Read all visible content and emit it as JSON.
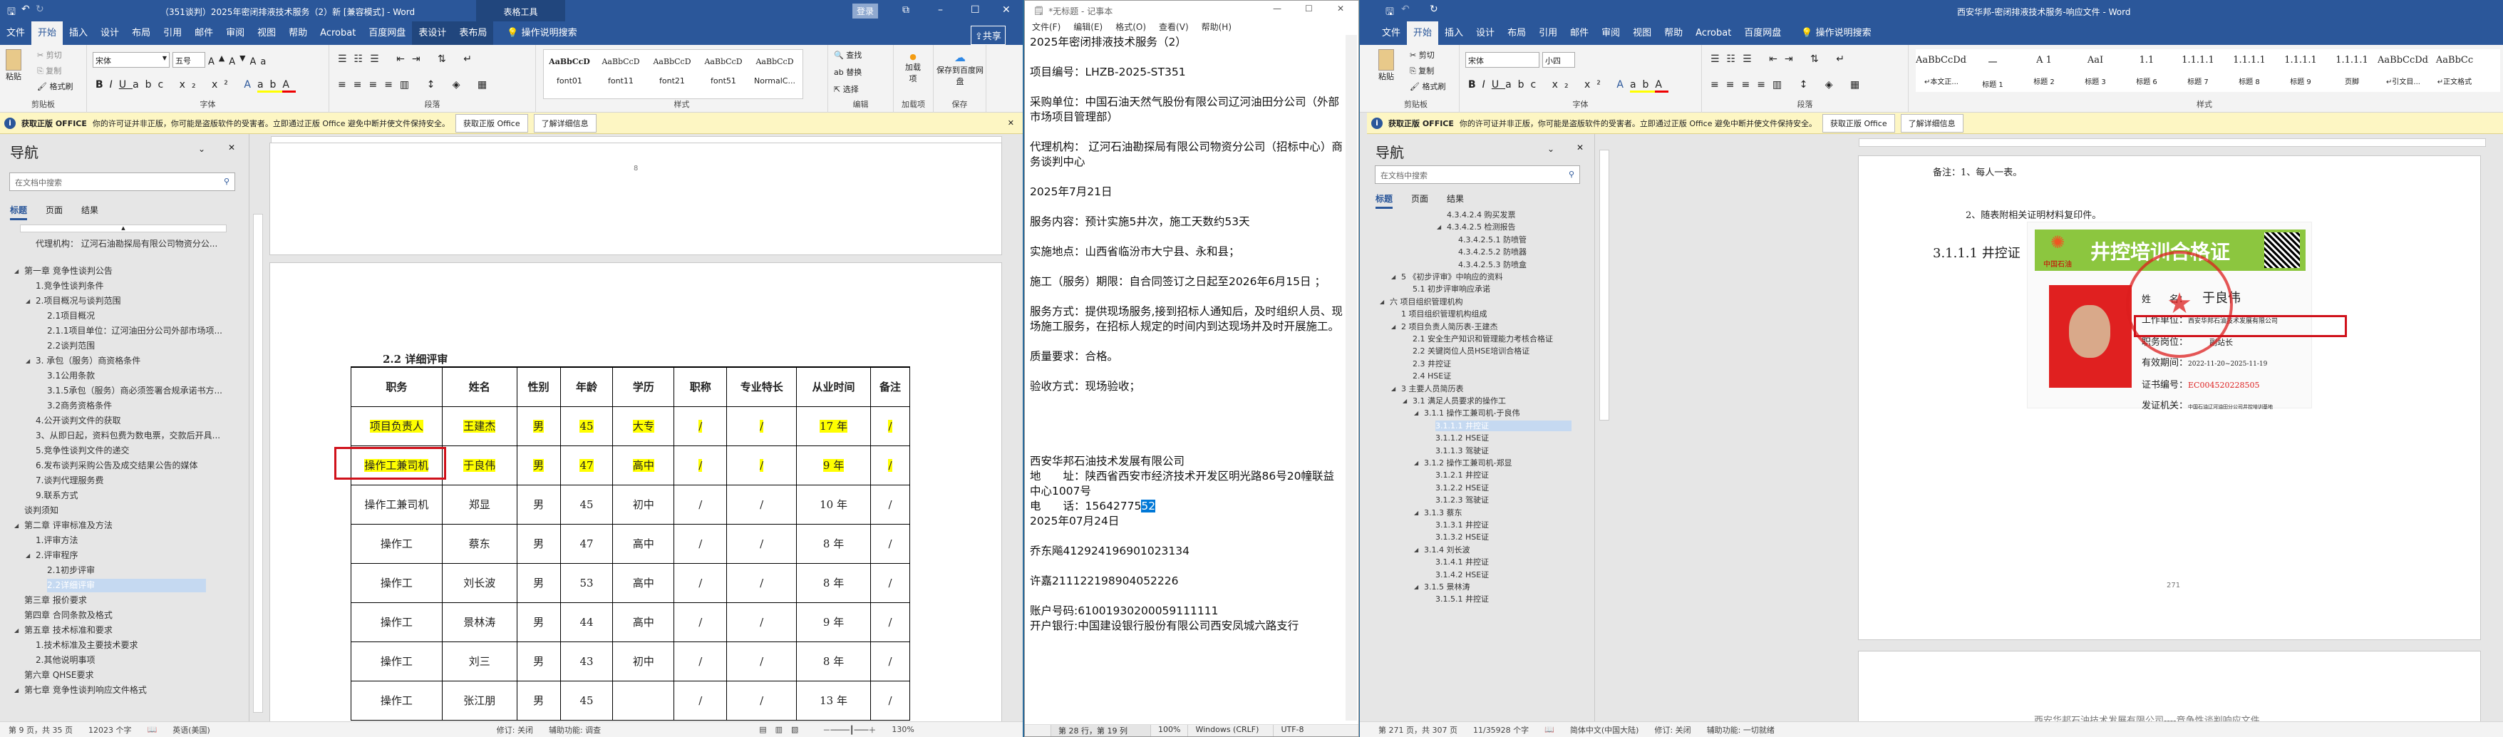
{
  "left_word": {
    "title": "（351谈判）2025年密闭排液技术服务（2）新 [兼容模式] - Word",
    "context_title": "表格工具",
    "login": "登录",
    "tabs": [
      "文件",
      "开始",
      "插入",
      "设计",
      "布局",
      "引用",
      "邮件",
      "审阅",
      "视图",
      "帮助",
      "Acrobat",
      "百度网盘",
      "表设计",
      "表布局"
    ],
    "tell_me": "操作说明搜索",
    "share": "共享",
    "ribbon": {
      "paste": "粘贴",
      "cut": "剪切",
      "copy": "复制",
      "format_painter": "格式刷",
      "clipboard": "剪贴板",
      "font_name": "宋体",
      "font_size": "五号",
      "font": "字体",
      "paragraph": "段落",
      "styles": [
        "font01",
        "font11",
        "font21",
        "font51",
        "NormalC..."
      ],
      "style_preview": "AaBbCcD",
      "styles_label": "样式",
      "find": "查找",
      "replace": "替换",
      "select": "选择",
      "editing": "编辑",
      "addins": "加载项",
      "addins_btn": "加载项",
      "save_baidu": "保存到百度网盘",
      "save": "保存"
    },
    "notice": {
      "title": "获取正版 OFFICE",
      "text": "你的许可证并非正版，你可能是盗版软件的受害者。立即通过正版 Office 避免中断并使文件保持安全。",
      "btn1": "获取正版 Office",
      "btn2": "了解详细信息"
    },
    "nav": {
      "title": "导航",
      "search": "在文档中搜索",
      "tabs": [
        "标题",
        "页面",
        "结果"
      ],
      "items": [
        {
          "t": "代理机构： 辽河石油勘探局有限公司物资分公...",
          "l": 1
        },
        {
          "t": "",
          "l": 0,
          "gap": true
        },
        {
          "t": "第一章 竞争性谈判公告",
          "l": 0,
          "e": true
        },
        {
          "t": "1.竞争性谈判条件",
          "l": 1
        },
        {
          "t": "2.项目概况与谈判范围",
          "l": 1,
          "e": true
        },
        {
          "t": "2.1项目概况",
          "l": 2
        },
        {
          "t": "2.1.1项目单位：辽河油田分公司外部市场项...",
          "l": 2
        },
        {
          "t": "2.2谈判范围",
          "l": 2
        },
        {
          "t": "3. 承包（服务）商资格条件",
          "l": 1,
          "e": true
        },
        {
          "t": "3.1公用条款",
          "l": 2
        },
        {
          "t": "3.1.5承包（服务）商必须签署合规承诺书方...",
          "l": 2
        },
        {
          "t": "3.2商务资格条件",
          "l": 2
        },
        {
          "t": "4.公开谈判文件的获取",
          "l": 1
        },
        {
          "t": "3、从即日起，资料包费为数电票，交款后开具...",
          "l": 1
        },
        {
          "t": "5.竞争性谈判文件的递交",
          "l": 1
        },
        {
          "t": "6.发布谈判采购公告及成交结果公告的媒体",
          "l": 1
        },
        {
          "t": "7.谈判代理服务费",
          "l": 1
        },
        {
          "t": "9.联系方式",
          "l": 1
        },
        {
          "t": "谈判须知",
          "l": 0
        },
        {
          "t": "第二章 评审标准及方法",
          "l": 0,
          "e": true
        },
        {
          "t": "1.评审方法",
          "l": 1
        },
        {
          "t": "2.评审程序",
          "l": 1,
          "e": true
        },
        {
          "t": "2.1初步评审",
          "l": 2
        },
        {
          "t": "2.2详细评审",
          "l": 2,
          "sel": true
        },
        {
          "t": "第三章 报价要求",
          "l": 0
        },
        {
          "t": "第四章 合同条款及格式",
          "l": 0
        },
        {
          "t": "第五章 技术标准和要求",
          "l": 0,
          "e": true
        },
        {
          "t": "1.技术标准及主要技术要求",
          "l": 1
        },
        {
          "t": "2.其他说明事项",
          "l": 1
        },
        {
          "t": "第六章 QHSE要求",
          "l": 0
        },
        {
          "t": "第七章 竞争性谈判响应文件格式",
          "l": 0,
          "e": true
        }
      ]
    },
    "prev_page_number": "8",
    "section_heading": "2.2 详细评审",
    "table": [
      [
        "职务",
        "姓名",
        "性别",
        "年龄",
        "学历",
        "职称",
        "专业特长",
        "从业时间",
        "备注"
      ],
      [
        "项目负责人",
        "王建杰",
        "男",
        "45",
        "大专",
        "/",
        "/",
        "17 年",
        "/"
      ],
      [
        "操作工兼司机",
        "于良伟",
        "男",
        "47",
        "高中",
        "/",
        "/",
        "9 年",
        "/"
      ],
      [
        "操作工兼司机",
        "郑显",
        "男",
        "45",
        "初中",
        "/",
        "/",
        "10 年",
        "/"
      ],
      [
        "操作工",
        "蔡东",
        "男",
        "47",
        "高中",
        "/",
        "/",
        "8 年",
        "/"
      ],
      [
        "操作工",
        "刘长波",
        "男",
        "53",
        "高中",
        "/",
        "/",
        "8 年",
        "/"
      ],
      [
        "操作工",
        "景林涛",
        "男",
        "44",
        "高中",
        "/",
        "/",
        "9 年",
        "/"
      ],
      [
        "操作工",
        "刘三",
        "男",
        "43",
        "初中",
        "/",
        "/",
        "8 年",
        "/"
      ],
      [
        "操作工",
        "张江朋",
        "男",
        "45",
        "",
        "/",
        "/",
        "13 年",
        "/"
      ]
    ],
    "highlighted_rows": [
      1,
      2
    ],
    "status": {
      "page": "第 9 页，共 35 页",
      "words": "12023 个字",
      "lang": "英语(美国)",
      "track": "修订: 关闭",
      "access": "辅助功能: 调查",
      "zoom": "130%"
    }
  },
  "notepad": {
    "title": "*无标题 - 记事本",
    "menu": [
      "文件(F)",
      "编辑(E)",
      "格式(O)",
      "查看(V)",
      "帮助(H)"
    ],
    "lines_before": "2025年密闭排液技术服务（2）\n\n项目编号：LHZB-2025-ST351\n\n采购单位：中国石油天然气股份有限公司辽河油田分公司（外部市场项目管理部）\n\n代理机构： 辽河石油勘探局有限公司物资分公司（招标中心）商务谈判中心\n\n2025年7月21日\n\n服务内容：预计实施5井次，施工天数约53天\n\n实施地点：山西省临汾市大宁县、永和县；\n\n施工（服务）期限：自合同签订之日起至2026年6月15日 ；\n\n服务方式：提供现场服务,接到招标人通知后，及时组织人员、现场施工服务，在招标人规定的时间内到达现场并及时开展施工。\n\n质量要求：合格。\n\n验收方式：现场验收；\n\n\n\n\n西安华邦石油技术发展有限公司\n地　　址：陕西省西安市经济技术开发区明光路86号20幢联益中心1007号\n",
    "phone_prefix": "电　　话：15642775",
    "phone_selected": "52",
    "lines_after": "\n2025年07月24日\n\n乔东飚412924196901023134\n\n许嘉211122198904052226\n\n账户号码:61001930200059111111\n开户银行:中国建设银行股份有限公司西安凤城六路支行",
    "status": {
      "pos": "第 28 行，第 19 列",
      "zoom": "100%",
      "eol": "Windows (CRLF)",
      "enc": "UTF-8"
    }
  },
  "right_word": {
    "title": "西安华邦-密闭排液技术服务-响应文件 - Word",
    "tabs": [
      "文件",
      "开始",
      "插入",
      "设计",
      "布局",
      "引用",
      "邮件",
      "审阅",
      "视图",
      "帮助",
      "Acrobat",
      "百度网盘"
    ],
    "tell_me": "操作说明搜索",
    "ribbon": {
      "paste": "粘贴",
      "cut": "剪切",
      "copy": "复制",
      "format_painter": "格式刷",
      "clipboard": "剪贴板",
      "font_name": "宋体",
      "font_size": "小四",
      "font": "字体",
      "paragraph": "段落",
      "styles": [
        "↵本文正...",
        "标题 1",
        "标题 2",
        "标题 3",
        "标题 6",
        "标题 7",
        "标题 8",
        "标题 9",
        "页脚",
        "↵引文目...",
        "↵正文格式"
      ],
      "style_previews": [
        "AaBbCcDdI",
        "一",
        "A 1",
        "AaI",
        "1.1",
        "1.1.1.1",
        "1.1.1.1",
        "1.1.1.1",
        "1.1.1.1",
        "AaBbCcDdEe",
        "AaBbCc"
      ],
      "styles_label": "样式"
    },
    "notice": {
      "title": "获取正版 OFFICE",
      "text": "你的许可证并非正版，你可能是盗版软件的受害者。立即通过正版 Office 避免中断并使文件保持安全。",
      "btn1": "获取正版 Office",
      "btn2": "了解详细信息"
    },
    "nav": {
      "title": "导航",
      "search": "在文档中搜索",
      "tabs": [
        "标题",
        "页面",
        "结果"
      ],
      "items": [
        {
          "t": "4.3.4.2.4 购买发票",
          "l": 5
        },
        {
          "t": "4.3.4.2.5 检测报告",
          "l": 5,
          "e": true
        },
        {
          "t": "4.3.4.2.5.1 防喷管",
          "l": 6
        },
        {
          "t": "4.3.4.2.5.2 防喷器",
          "l": 6
        },
        {
          "t": "4.3.4.2.5.3 防喷盒",
          "l": 6
        },
        {
          "t": "5 《初步评审》中响应的资料",
          "l": 1,
          "e": true
        },
        {
          "t": "5.1 初步评审响应承诺",
          "l": 2
        },
        {
          "t": "六 项目组织管理机构",
          "l": 0,
          "e": true
        },
        {
          "t": "1 项目组织管理机构组成",
          "l": 1
        },
        {
          "t": "2 项目负责人简历表-王建杰",
          "l": 1,
          "e": true
        },
        {
          "t": "2.1 安全生产知识和管理能力考核合格证",
          "l": 2
        },
        {
          "t": "2.2 关键岗位人员HSE培训合格证",
          "l": 2
        },
        {
          "t": "2.3 井控证",
          "l": 2
        },
        {
          "t": "2.4 HSE证",
          "l": 2
        },
        {
          "t": "3 主要人员简历表",
          "l": 1,
          "e": true
        },
        {
          "t": "3.1 满足人员要求的操作工",
          "l": 2,
          "e": true
        },
        {
          "t": "3.1.1 操作工兼司机-于良伟",
          "l": 3,
          "e": true
        },
        {
          "t": "3.1.1.1 井控证",
          "l": 4,
          "sel": true
        },
        {
          "t": "3.1.1.2 HSE证",
          "l": 4
        },
        {
          "t": "3.1.1.3 驾驶证",
          "l": 4
        },
        {
          "t": "3.1.2 操作工兼司机-郑显",
          "l": 3,
          "e": true
        },
        {
          "t": "3.1.2.1 井控证",
          "l": 4
        },
        {
          "t": "3.1.2.2 HSE证",
          "l": 4
        },
        {
          "t": "3.1.2.3 驾驶证",
          "l": 4
        },
        {
          "t": "3.1.3 蔡东",
          "l": 3,
          "e": true
        },
        {
          "t": "3.1.3.1 井控证",
          "l": 4
        },
        {
          "t": "3.1.3.2 HSE证",
          "l": 4
        },
        {
          "t": "3.1.4 刘长波",
          "l": 3,
          "e": true
        },
        {
          "t": "3.1.4.1 井控证",
          "l": 4
        },
        {
          "t": "3.1.4.2 HSE证",
          "l": 4
        },
        {
          "t": "3.1.5 景林涛",
          "l": 3,
          "e": true
        },
        {
          "t": "3.1.5.1 井控证",
          "l": 4
        }
      ]
    },
    "page": {
      "note1": "备注：1、每人一表。",
      "note2": "2、随表附相关证明材料复印件。",
      "heading": "3.1.1.1 井控证",
      "page_number": "271",
      "next_header": "西安华邦石油技术发展有限公司----竞争性谈判响应文件"
    },
    "certificate": {
      "brand": "中国石油",
      "title": "井控培训合格证",
      "name_label": "姓　　名：",
      "name": "于良伟",
      "unit_label": "工作单位：",
      "unit": "西安华邦石油技术发展有限公司",
      "post_label": "职务岗位：",
      "post": "副站长",
      "valid_label": "有效期间：",
      "valid": "2022-11-20~2025-11-19",
      "no_label": "证书编号：",
      "no": "EC004520228505",
      "issuer_label": "发证机关：",
      "issuer": "中国石油辽河油田分公司井控培训基地",
      "stamp": "中国石油辽河油田分公司井控培训基地"
    },
    "status": {
      "page": "第 271 页，共 307 页",
      "words": "11/35928 个字",
      "lang": "简体中文(中国大陆)",
      "track": "修订: 关闭",
      "access": "辅助功能: 一切就绪"
    }
  },
  "colors": {
    "word_blue": "#2b579a",
    "highlight": "#ffff00",
    "annotation_red": "#d0121b",
    "nav_selected": "#c5d9f1"
  }
}
